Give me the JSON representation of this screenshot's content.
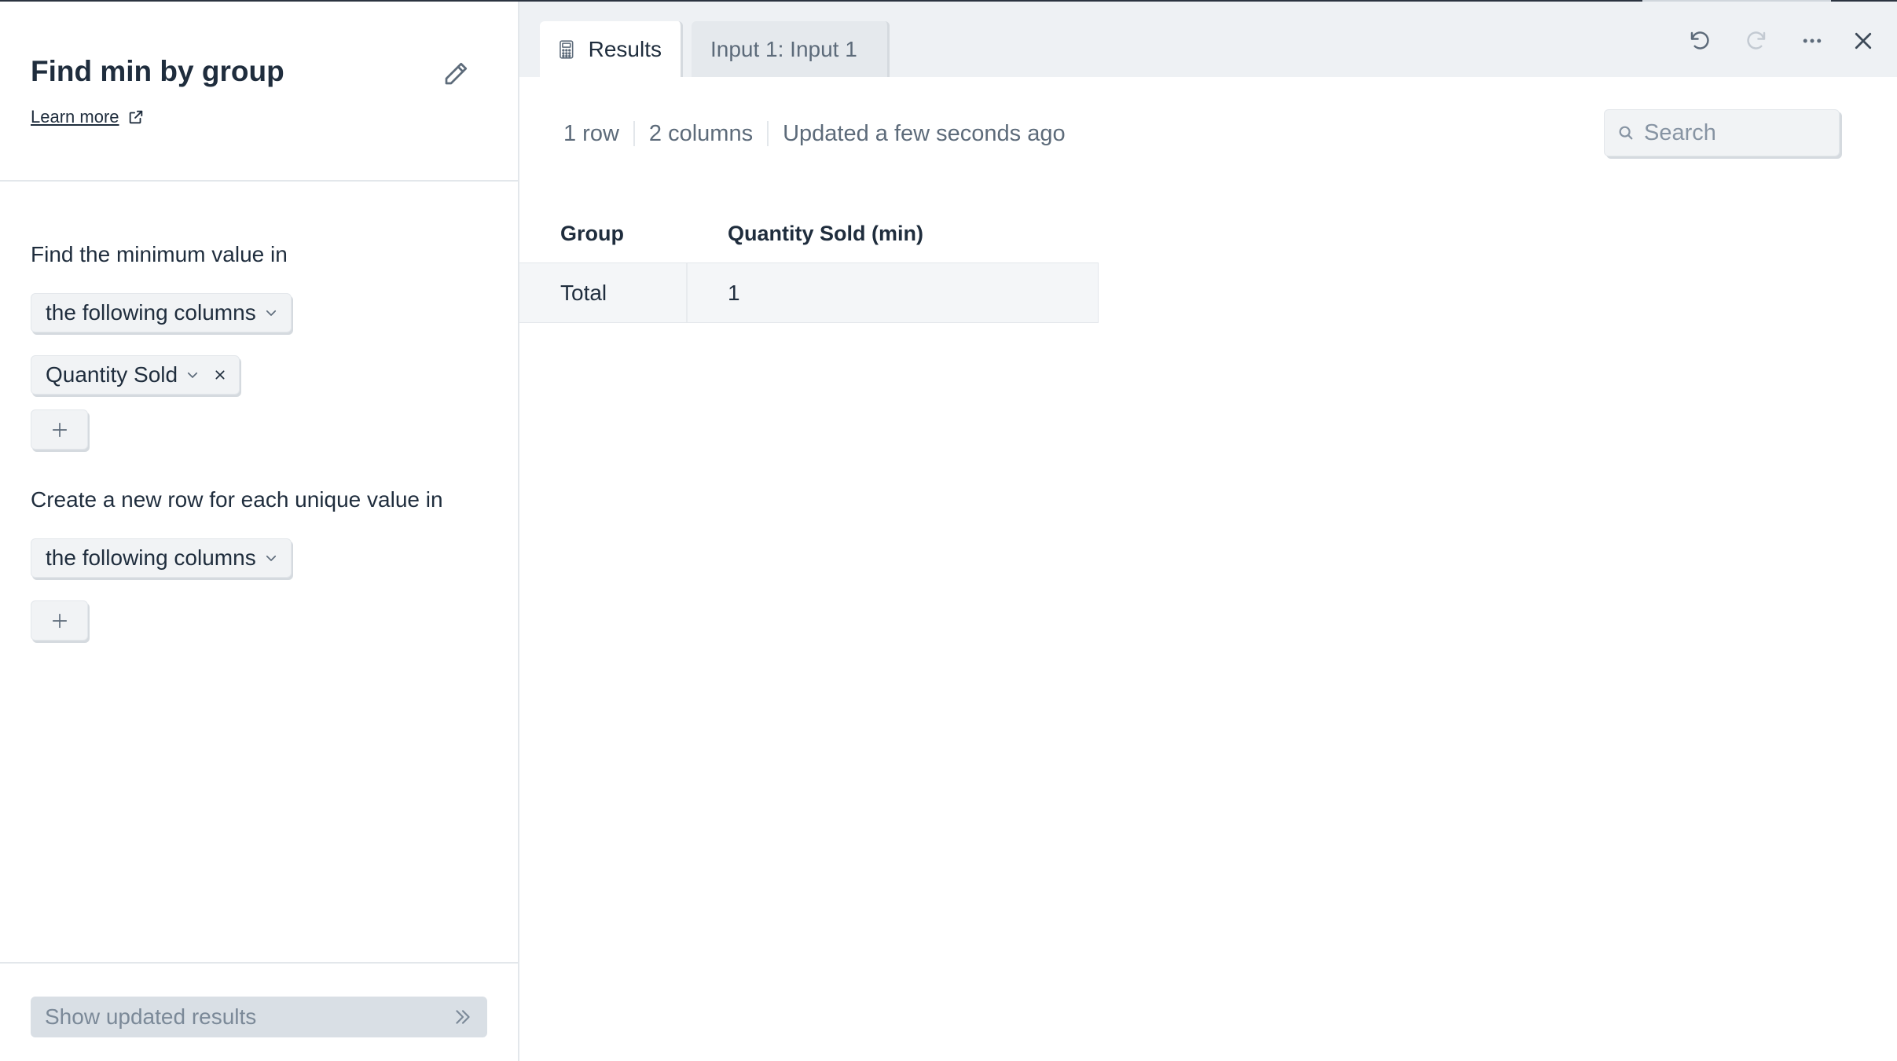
{
  "step": {
    "title": "Find min by group",
    "learn_more": "Learn more"
  },
  "config": {
    "find_label": "Find the minimum value in",
    "find_mode": "the following columns",
    "selected_columns": [
      "Quantity Sold"
    ],
    "group_label": "Create a new row for each unique value in",
    "group_mode": "the following columns"
  },
  "footer": {
    "show_results": "Show updated results"
  },
  "tabs": [
    {
      "label": "Results",
      "icon": "calculator-icon",
      "active": true
    },
    {
      "label": "Input 1: Input 1",
      "active": false
    }
  ],
  "toolbar": [
    "undo-icon",
    "redo-icon",
    "more-icon",
    "close-icon"
  ],
  "results": {
    "rows_text": "1 row",
    "columns_text": "2 columns",
    "updated_text": "Updated a few seconds ago",
    "search_placeholder": "Search",
    "headers": [
      "Group",
      "Quantity Sold (min)"
    ],
    "rows": [
      [
        "Total",
        "1"
      ]
    ]
  },
  "colors": {
    "text": "#1f2d3d",
    "muted": "#5d6b7a",
    "panel_bg": "#eef1f4",
    "disabled_button": "#d9dfe5"
  }
}
